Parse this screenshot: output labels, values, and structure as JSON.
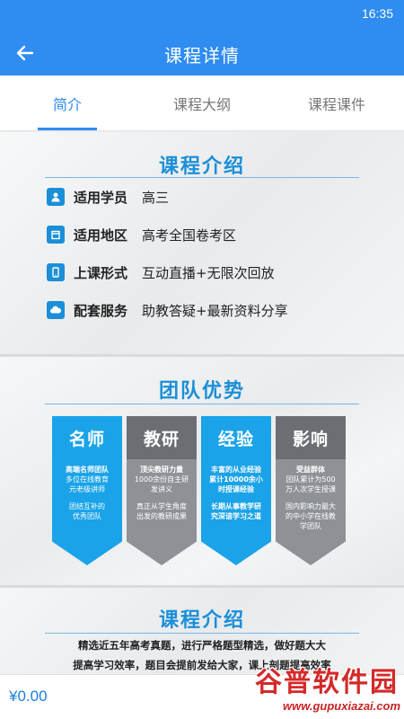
{
  "status_bar": {
    "time": "16:35"
  },
  "app_bar": {
    "title": "课程详情",
    "back_icon": "arrow-left-icon"
  },
  "tabs": [
    {
      "label": "简介",
      "active": true
    },
    {
      "label": "课程大纲",
      "active": false
    },
    {
      "label": "课程课件",
      "active": false
    }
  ],
  "course_intro": {
    "title": "课程介绍",
    "rows": [
      {
        "icon": "person-icon",
        "label": "适用学员",
        "value": "高三"
      },
      {
        "icon": "calendar-icon",
        "label": "适用地区",
        "value": "高考全国卷考区"
      },
      {
        "icon": "phone-icon",
        "label": "上课形式",
        "value": "互动直播+无限次回放"
      },
      {
        "icon": "cloud-icon",
        "label": "配套服务",
        "value": "助教答疑+最新资料分享"
      }
    ]
  },
  "team": {
    "title": "团队优势",
    "cards": [
      {
        "title": "名师",
        "color": "blue",
        "lines_a": [
          "高端名师团队",
          "多位在线教育",
          "元老级讲师"
        ],
        "lines_b": [
          "团结互补的",
          "优秀团队"
        ]
      },
      {
        "title": "教研",
        "color": "gray",
        "lines_a": [
          "顶尖教研力量",
          "1000余份自主研",
          "发讲义"
        ],
        "lines_b": [
          "真正从学生角度",
          "出发的教研成果"
        ]
      },
      {
        "title": "经验",
        "color": "blue",
        "lines_a": [
          "丰富的从业经验",
          "累计10000余小",
          "时授课经验"
        ],
        "lines_b": [
          "长期从事教学研",
          "究深谙学习之道"
        ]
      },
      {
        "title": "影响",
        "color": "gray",
        "lines_a": [
          "受益群体",
          "团队累计为500",
          "万人次学生授课"
        ],
        "lines_b": [
          "国内影响力最大",
          "的中小学在线教",
          "学团队"
        ]
      }
    ]
  },
  "course_intro_2": {
    "title": "课程介绍",
    "line1": "精选近五年高考真题，进行严格题型精选，做好题大大",
    "line2": "提高学习效率，题目会提前发给大家，课上剖题提高效率"
  },
  "bottom_bar": {
    "price": "¥0.00"
  },
  "watermark": {
    "text": "谷普软件园",
    "url": "www.gupuxiazai.com"
  },
  "colors": {
    "primary": "#2f8cf0",
    "accent_blue": "#1aa3e8",
    "card_gray": "#8e9297",
    "price": "#1a7fe0"
  }
}
